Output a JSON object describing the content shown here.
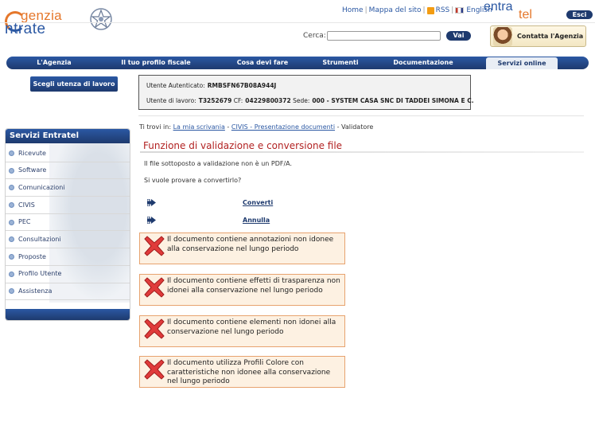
{
  "header": {
    "logo_line1": "genzia",
    "logo_line2": "ntrate",
    "links": [
      "Home",
      "Mappa del sito",
      "RSS",
      "English"
    ],
    "entratel_1": "entra",
    "entratel_2": "tel",
    "esci_label": "Esci",
    "search_label": "Cerca:",
    "search_value": "",
    "search_button": "Vai",
    "contatta_label": "Contatta l'Agenzia"
  },
  "nav": {
    "items": [
      "L'Agenzia",
      "Il tuo profilo fiscale",
      "Cosa devi fare",
      "Strumenti",
      "Documentazione",
      "Servizi online"
    ],
    "active": "Servizi online"
  },
  "user": {
    "scegli_label": "Scegli utenza di lavoro",
    "auth_label": "Utente Autenticato:",
    "auth_value": "RMBSFN67B08A944J",
    "work_label": "Utente di lavoro:",
    "work_value": "T3252679",
    "cf_label": "CF:",
    "cf_value": "04229800372",
    "sede_label": "Sede:",
    "sede_value": "000 - SYSTEM CASA SNC DI TADDEI SIMONA E C."
  },
  "sidebar": {
    "title": "Servizi Entratel",
    "items": [
      "Ricevute",
      "Software",
      "Comunicazioni",
      "CIVIS",
      "PEC",
      "Consultazioni",
      "Proposte",
      "Profilo Utente",
      "Assistenza"
    ]
  },
  "breadcrumb": {
    "prefix": "Ti trovi in:",
    "link1": "La mia scrivania",
    "sep": "-",
    "link2": "CIVIS - Presentazione documenti",
    "current": "Validatore"
  },
  "main": {
    "title": "Funzione di validazione e conversione file",
    "msg1": "Il file sottoposto a validazione non è un PDF/A.",
    "msg2": "Si vuole provare a convertirlo?",
    "converti": "Converti",
    "annulla": "Annulla",
    "errors": [
      "Il documento contiene annotazioni non idonee alla conservazione nel lungo periodo",
      "Il documento contiene effetti di trasparenza non idonei alla conservazione nel lungo periodo",
      "Il documento contiene elementi non idonei alla conservazione nel lungo periodo",
      "Il documento utilizza Profili Colore con caratteristiche non idonee alla conservazione nel lungo periodo"
    ]
  },
  "colors": {
    "brand_blue": "#1e3a6e",
    "brand_orange": "#e5772b",
    "title_red": "#b22222",
    "error_bg": "#fdf1e2",
    "error_border": "#e7a36f"
  }
}
